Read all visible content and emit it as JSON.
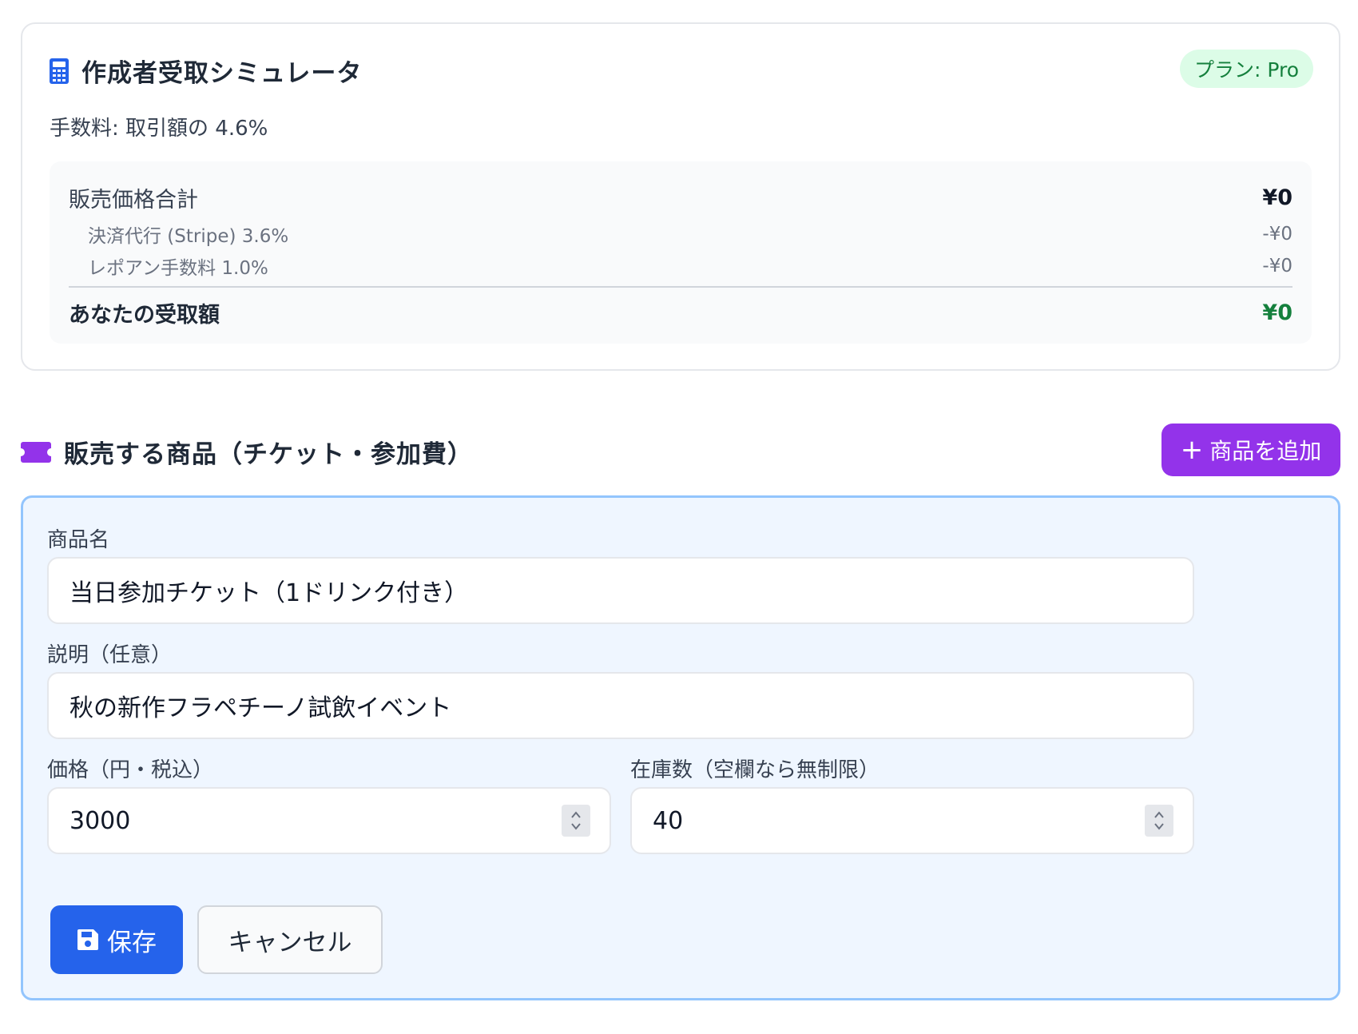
{
  "simulator": {
    "title": "作成者受取シミュレータ",
    "plan_badge": "プラン: Pro",
    "fee_note": "手数料: 取引額の 4.6%",
    "rows": {
      "sales_total_label": "販売価格合計",
      "sales_total_value": "¥0",
      "stripe_label": "決済代行 (Stripe) 3.6%",
      "stripe_value": "-¥0",
      "platform_label": "レポアン手数料 1.0%",
      "platform_value": "-¥0",
      "net_label": "あなたの受取額",
      "net_value": "¥0"
    },
    "icon": "calculator-icon"
  },
  "products": {
    "title": "販売する商品（チケット・参加費）",
    "add_button_label": "商品を追加",
    "icon": "ticket-icon",
    "form": {
      "name_label": "商品名",
      "name_value": "当日参加チケット（1ドリンク付き）",
      "desc_label": "説明（任意）",
      "desc_value": "秋の新作フラペチーノ試飲イベント",
      "price_label": "価格（円・税込）",
      "price_value": "3000",
      "stock_label": "在庫数（空欄なら無制限）",
      "stock_value": "40",
      "save_label": "保存",
      "cancel_label": "キャンセル"
    }
  },
  "colors": {
    "accent_purple": "#9333ea",
    "primary_blue": "#2563eb",
    "success_green": "#15803d",
    "badge_bg": "#dcfce7",
    "form_bg": "#eff6ff",
    "form_border": "#93c5fd"
  }
}
